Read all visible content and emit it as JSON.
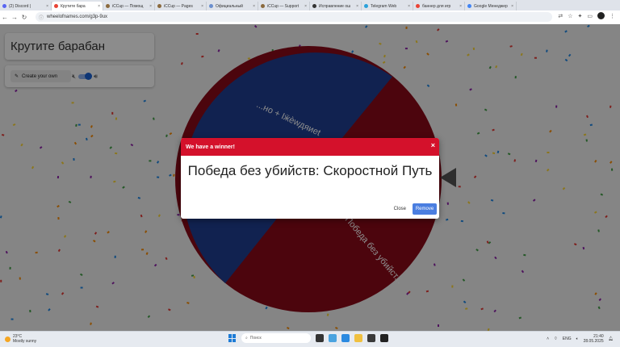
{
  "browser": {
    "tabs": [
      {
        "label": "(2) Discord |",
        "color": "#5865f2",
        "active": false
      },
      {
        "label": "Крутите бара",
        "color": "#e84335",
        "active": true
      },
      {
        "label": "iCCup — Помощ",
        "color": "#8b6a3e",
        "active": false
      },
      {
        "label": "iCCup — Pages",
        "color": "#8b6a3e",
        "active": false
      },
      {
        "label": "Официальный",
        "color": "#6b8fce",
        "active": false
      },
      {
        "label": "iCCup — Support",
        "color": "#8b6a3e",
        "active": false
      },
      {
        "label": "Исправление ош",
        "color": "#333333",
        "active": false
      },
      {
        "label": "Telegram Web",
        "color": "#2aa1da",
        "active": false
      },
      {
        "label": "баннер для игр",
        "color": "#ea4335",
        "active": false
      },
      {
        "label": "Google Менеджер",
        "color": "#4285f4",
        "active": false
      }
    ],
    "url": "wheelofnames.com/g3p-9ux"
  },
  "app": {
    "title": "Крутите барабан",
    "create_label": "Create your own"
  },
  "wheel": {
    "segments": [
      {
        "label": "...но + Іӝѐwдяиеt",
        "color": "#1f3f93"
      },
      {
        "label": "Победа без убийст...",
        "color": "#8b0a18"
      }
    ]
  },
  "dialog": {
    "header": "We have a winner!",
    "close_icon": "×",
    "winner": "Победа без убийств: Скоростной Путь",
    "close_label": "Close",
    "remove_label": "Remove"
  },
  "taskbar": {
    "temp": "23°C",
    "condition": "Mostly sunny",
    "search_placeholder": "Поиск",
    "lang": "ENG",
    "time": "21:40",
    "date": "28.05.2025"
  },
  "colors": {
    "header_red": "#d4112b",
    "remove_blue": "#4a7ee0",
    "wheel_blue": "#1f3f93",
    "wheel_red": "#8b0a18"
  }
}
